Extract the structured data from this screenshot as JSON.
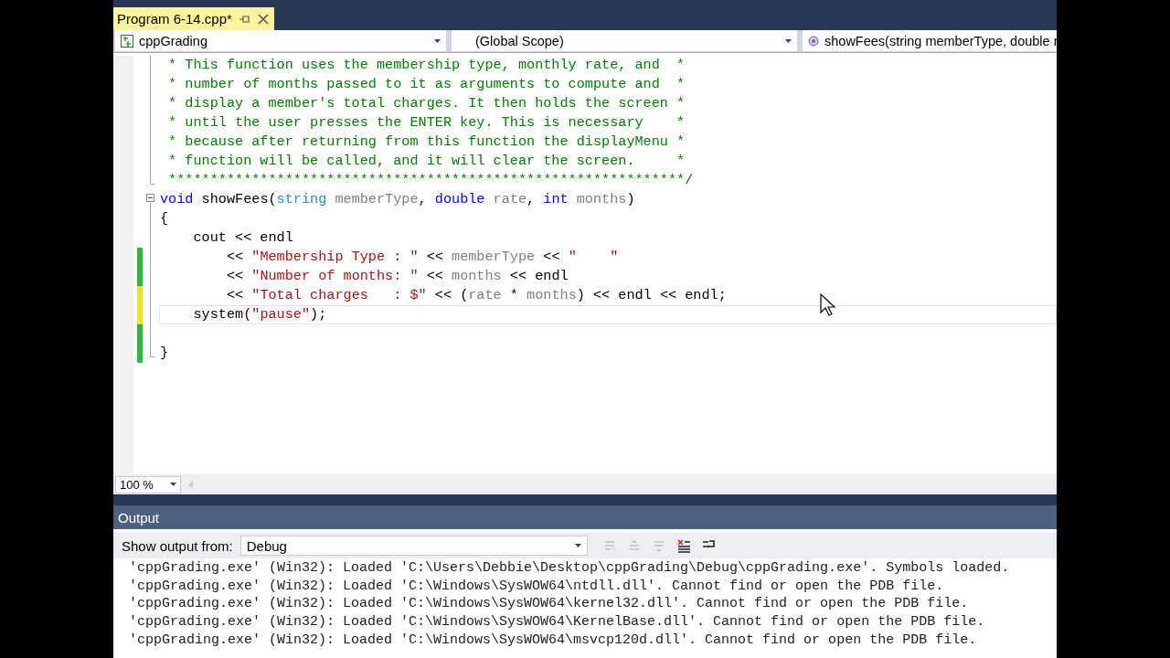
{
  "document_tab": {
    "label": "Program 6-14.cpp*",
    "selected": true
  },
  "navigation": {
    "project": "cppGrading",
    "scope": "(Global Scope)",
    "member": "showFees(string memberType, double r"
  },
  "editor": {
    "zoom": "100 %",
    "lines": [
      {
        "kind": "code",
        "current": false,
        "tokens": [
          {
            "kind": "comment",
            "text": " * This function uses the membership type, monthly rate, and  *"
          }
        ]
      },
      {
        "kind": "code",
        "current": false,
        "tokens": [
          {
            "kind": "comment",
            "text": " * number of months passed to it as arguments to compute and  *"
          }
        ]
      },
      {
        "kind": "code",
        "current": false,
        "tokens": [
          {
            "kind": "comment",
            "text": " * display a member's total charges. It then holds the screen *"
          }
        ]
      },
      {
        "kind": "code",
        "current": false,
        "tokens": [
          {
            "kind": "comment",
            "text": " * until the user presses the ENTER key. This is necessary    *"
          }
        ]
      },
      {
        "kind": "code",
        "current": false,
        "tokens": [
          {
            "kind": "comment",
            "text": " * because after returning from this function the displayMenu *"
          }
        ]
      },
      {
        "kind": "code",
        "current": false,
        "tokens": [
          {
            "kind": "comment",
            "text": " * function will be called, and it will clear the screen.     *"
          }
        ]
      },
      {
        "kind": "fold-end",
        "current": false,
        "tokens": [
          {
            "kind": "comment",
            "text": " **************************************************************/"
          }
        ]
      },
      {
        "kind": "fold-start",
        "current": false,
        "tokens": [
          {
            "kind": "keyword",
            "text": "void"
          },
          {
            "kind": "plain",
            "text": " showFees("
          },
          {
            "kind": "type",
            "text": "string"
          },
          {
            "kind": "param",
            "text": " memberType"
          },
          {
            "kind": "plain",
            "text": ", "
          },
          {
            "kind": "keyword",
            "text": "double"
          },
          {
            "kind": "param",
            "text": " rate"
          },
          {
            "kind": "plain",
            "text": ", "
          },
          {
            "kind": "keyword",
            "text": "int"
          },
          {
            "kind": "param",
            "text": " months"
          },
          {
            "kind": "plain",
            "text": ")"
          }
        ]
      },
      {
        "kind": "code",
        "current": false,
        "tokens": [
          {
            "kind": "plain",
            "text": "{"
          }
        ]
      },
      {
        "kind": "code",
        "current": false,
        "tokens": [
          {
            "kind": "plain",
            "text": "    cout << endl"
          }
        ]
      },
      {
        "kind": "code",
        "color": "#2ebb3d",
        "current": false,
        "tokens": [
          {
            "kind": "plain",
            "text": "        << "
          },
          {
            "kind": "string",
            "text": "\"Membership Type : \""
          },
          {
            "kind": "plain",
            "text": " << "
          },
          {
            "kind": "param",
            "text": "memberType"
          },
          {
            "kind": "plain",
            "text": " << "
          },
          {
            "kind": "string",
            "text": "\"    \""
          }
        ]
      },
      {
        "kind": "code",
        "color": "#2ebb3d",
        "current": false,
        "tokens": [
          {
            "kind": "plain",
            "text": "        << "
          },
          {
            "kind": "string",
            "text": "\"Number of months: \""
          },
          {
            "kind": "plain",
            "text": " << "
          },
          {
            "kind": "param",
            "text": "months"
          },
          {
            "kind": "plain",
            "text": " << endl"
          }
        ]
      },
      {
        "kind": "code",
        "color": "#ede22a",
        "current": false,
        "tokens": [
          {
            "kind": "plain",
            "text": "        << "
          },
          {
            "kind": "string",
            "text": "\"Total charges   : $\""
          },
          {
            "kind": "plain",
            "text": " << ("
          },
          {
            "kind": "param",
            "text": "rate"
          },
          {
            "kind": "plain",
            "text": " * "
          },
          {
            "kind": "param",
            "text": "months"
          },
          {
            "kind": "plain",
            "text": ") << endl << endl;"
          }
        ]
      },
      {
        "kind": "code",
        "color": "#ede22a",
        "current": true,
        "tokens": [
          {
            "kind": "plain",
            "text": "    system("
          },
          {
            "kind": "string",
            "text": "\"pause\""
          },
          {
            "kind": "plain",
            "text": ");"
          }
        ]
      },
      {
        "kind": "code",
        "color": "#2ebb3d",
        "current": false
      },
      {
        "kind": "fold-end",
        "color": "#2ebb3d",
        "current": false,
        "tokens": [
          {
            "kind": "plain",
            "text": "}"
          }
        ]
      }
    ]
  },
  "output": {
    "title": "Output",
    "source_label": "Show output from:",
    "source": "Debug",
    "tools": [
      {
        "kind": "find-previous",
        "disabled": true
      },
      {
        "kind": "go-previous",
        "disabled": true
      },
      {
        "kind": "go-next",
        "disabled": true
      },
      {
        "kind": "clear-all",
        "disabled": false
      },
      {
        "kind": "word-wrap",
        "disabled": false
      }
    ],
    "lines": [
      "'cppGrading.exe' (Win32): Loaded 'C:\\Users\\Debbie\\Desktop\\cppGrading\\Debug\\cppGrading.exe'. Symbols loaded.",
      "'cppGrading.exe' (Win32): Loaded 'C:\\Windows\\SysWOW64\\ntdll.dll'. Cannot find or open the PDB file.",
      "'cppGrading.exe' (Win32): Loaded 'C:\\Windows\\SysWOW64\\kernel32.dll'. Cannot find or open the PDB file.",
      "'cppGrading.exe' (Win32): Loaded 'C:\\Windows\\SysWOW64\\KernelBase.dll'. Cannot find or open the PDB file.",
      "'cppGrading.exe' (Win32): Loaded 'C:\\Windows\\SysWOW64\\msvcp120d.dll'. Cannot find or open the PDB file."
    ]
  }
}
